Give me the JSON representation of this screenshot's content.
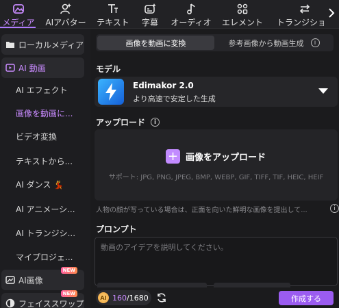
{
  "toolbar": {
    "items": [
      {
        "label": "メディア",
        "icon": "media-icon"
      },
      {
        "label": "AIアバター",
        "icon": "ai-avatar-icon"
      },
      {
        "label": "テキスト",
        "icon": "text-icon"
      },
      {
        "label": "字幕",
        "icon": "subtitle-icon"
      },
      {
        "label": "オーディオ",
        "icon": "audio-icon"
      },
      {
        "label": "エレメント",
        "icon": "element-icon"
      },
      {
        "label": "トランジション",
        "icon": "transition-icon"
      }
    ],
    "active_index": 0,
    "next_icon": "chevron-right-icon"
  },
  "sidebar": {
    "local_media": "ローカルメディア",
    "ai_video": "AI 動画",
    "subitems": [
      "AI エフェクト",
      "画像を動画に...",
      "ビデオ変換",
      "テキストから...",
      "AI ダンス 💃",
      "AI アニメーシ...",
      "AI トランジシ...",
      "マイプロジェ..."
    ],
    "active_sub_index": 1,
    "ai_image": "AI画像",
    "face_swap": "フェイススワップ",
    "new_badge": "NEW"
  },
  "main": {
    "tabs": {
      "active": "画像を動画に変換",
      "other": "参考画像から動画生成"
    },
    "model": {
      "section": "モデル",
      "name": "Edimakor 2.0",
      "desc": "より高速で安定した生成"
    },
    "upload": {
      "section": "アップロード",
      "button": "画像をアップロード",
      "support": "サポート: JPG, PNG, JPEG, BMP, WEBP, GIF, TIFF, TIF, HEIC, HEIF"
    },
    "face_tip": "人物の顔が写っている場合は、正面を向いた鮮明な画像を提出して...",
    "prompt": {
      "section": "プロンプト",
      "placeholder": "動画のアイデアを説明してください。"
    },
    "credits": {
      "coin": "AI",
      "used": "160",
      "total": "/1680"
    },
    "create": "作成する"
  },
  "colors": {
    "accent": "#b07cff",
    "create_button": "#9b5cf0",
    "background": "#1b1b1d"
  }
}
